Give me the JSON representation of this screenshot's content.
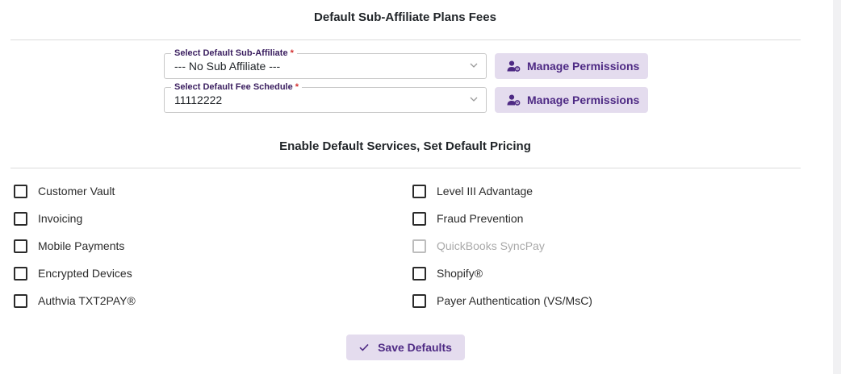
{
  "sections": {
    "plans_title": "Default Sub-Affiliate Plans Fees",
    "services_title": "Enable Default Services, Set Default Pricing"
  },
  "fields": {
    "sub_affiliate": {
      "label": "Select Default Sub-Affiliate",
      "required_mark": "*",
      "value": "--- No Sub Affiliate ---"
    },
    "fee_schedule": {
      "label": "Select Default Fee Schedule",
      "required_mark": "*",
      "value": "11112222"
    }
  },
  "buttons": {
    "manage_permissions": "Manage Permissions",
    "save_defaults": "Save Defaults"
  },
  "services": {
    "left": [
      {
        "label": "Customer Vault",
        "checked": false,
        "disabled": false
      },
      {
        "label": "Invoicing",
        "checked": false,
        "disabled": false
      },
      {
        "label": "Mobile Payments",
        "checked": false,
        "disabled": false
      },
      {
        "label": "Encrypted Devices",
        "checked": false,
        "disabled": false
      },
      {
        "label": "Authvia TXT2PAY®",
        "checked": false,
        "disabled": false
      }
    ],
    "right": [
      {
        "label": "Level III Advantage",
        "checked": false,
        "disabled": false
      },
      {
        "label": "Fraud Prevention",
        "checked": false,
        "disabled": false
      },
      {
        "label": "QuickBooks SyncPay",
        "checked": false,
        "disabled": true
      },
      {
        "label": "Shopify®",
        "checked": false,
        "disabled": false
      },
      {
        "label": "Payer Authentication (VS/MsC)",
        "checked": false,
        "disabled": false
      }
    ]
  },
  "icons": {
    "manage_permissions": "user-gear-icon",
    "select_caret": "chevron-down-icon",
    "save": "check-icon"
  },
  "colors": {
    "accent_text": "#4e2a84",
    "button_bg": "#e4dcee",
    "required": "#d32f2f"
  }
}
